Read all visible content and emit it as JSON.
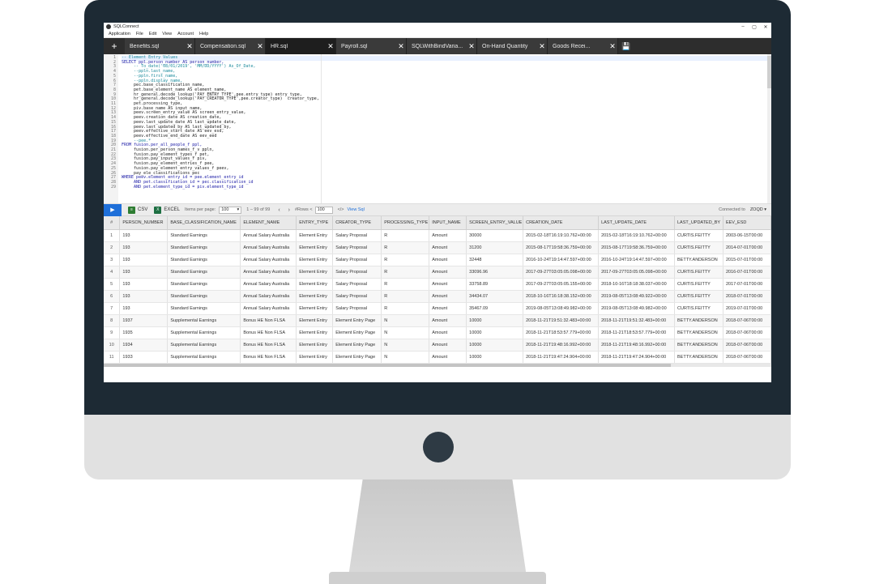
{
  "window": {
    "title": "SQLConnect",
    "controls": [
      "–",
      "▢",
      "✕"
    ]
  },
  "menu": [
    "Application",
    "File",
    "Edit",
    "View",
    "Account",
    "Help"
  ],
  "tabs": [
    {
      "label": "Benefits.sql",
      "active": false
    },
    {
      "label": "Compensation.sql",
      "active": false
    },
    {
      "label": "HR.sql",
      "active": true
    },
    {
      "label": "Payroll.sql",
      "active": false
    },
    {
      "label": "SQLWithBindVaria...",
      "active": false
    },
    {
      "label": "On-Hand Quantity",
      "active": false
    },
    {
      "label": "Goods Recei...",
      "active": false
    }
  ],
  "editor": {
    "line_numbers": [
      "1",
      "2",
      "3",
      "4",
      "5",
      "6",
      "7",
      "8",
      "9",
      "10",
      "11",
      "12",
      "13",
      "14",
      "15",
      "16",
      "17",
      "18",
      "19",
      "20",
      "21",
      "22",
      "23",
      "24",
      "25",
      "26",
      "27",
      "28",
      "29"
    ],
    "lines": [
      "-- Element Entry Values",
      "SELECT ppl.person_number AS person_number,",
      "     -- To_date('08/01/2019', 'MM/DD/YYYY') As_Of_Date,",
      "     --ppln.last_name,",
      "     --ppln.first_name,",
      "     --ppln.display_name,",
      "     pec.base_classification_name,",
      "     pet.base_element_name AS element_name,",
      "     hr_general.decode_lookup('PAY_ENTRY_TYPE',pee.entry_type) entry_type,",
      "     hr_general.decode_lookup('PAY_CREATOR_TYPE',pee.creator_type)  creator_type,",
      "     pet.processing_type,",
      "     piv.base_name AS input_name,",
      "     peev.screen_entry_value AS screen_entry_value,",
      "     peev.creation_date AS creation_date,",
      "     peev.last_update_date AS last_update_date,",
      "     peev.last_updated_by AS last_updated_by,",
      "     peev.effective_start_date AS eev_esd,",
      "     peev.effective_end_date AS eev_eed",
      "     --pee.*",
      "FROM fusion.per_all_people_f ppl,",
      "     fusion.per_person_names_f_v ppln,",
      "     fusion.pay_element_types_f pet,",
      "     fusion.pay_input_values_f piv,",
      "     fusion.pay_element_entries_f pee,",
      "     fusion.pay_element_entry_values_f peev,",
      "     pay_ele_classifications pec",
      "WHERE peev.element_entry_id = pee.element_entry_id",
      "     AND pet.classification_id = pec.classification_id",
      "     AND pet.element_type_id = piv.element_type_id"
    ]
  },
  "toolbar": {
    "run_icon": "▶",
    "csv_label": "CSV",
    "excel_label": "EXCEL",
    "items_per_page_label": "Items per page:",
    "items_per_page_value": "100",
    "range_text": "1 – 99 of 99",
    "rows_label": "#Rows <",
    "rows_value": "100",
    "view_sql_label": "View Sql",
    "connected_label": "Connected to",
    "connected_value": "ZOQD"
  },
  "grid": {
    "columns": [
      "#",
      "PERSON_NUMBER",
      "BASE_CLASSIFICATION_NAME",
      "ELEMENT_NAME",
      "ENTRY_TYPE",
      "CREATOR_TYPE",
      "PROCESSING_TYPE",
      "INPUT_NAME",
      "SCREEN_ENTRY_VALUE",
      "CREATION_DATE",
      "LAST_UPDATE_DATE",
      "LAST_UPDATED_BY",
      "EEV_ESD"
    ],
    "rows": [
      [
        "1",
        "193",
        "Standard Earnings",
        "Annual Salary Australia",
        "Element Entry",
        "Salary Proposal",
        "R",
        "Amount",
        "30000",
        "2015-02-18T16:19:10.762+00:00",
        "2015-02-18T16:19:10.762+00:00",
        "CURTIS.FEITTY",
        "2003-06-15T00:00"
      ],
      [
        "2",
        "193",
        "Standard Earnings",
        "Annual Salary Australia",
        "Element Entry",
        "Salary Proposal",
        "R",
        "Amount",
        "31200",
        "2015-08-17T19:58:36.759+00:00",
        "2015-08-17T19:58:36.759+00:00",
        "CURTIS.FEITTY",
        "2014-07-01T00:00"
      ],
      [
        "3",
        "193",
        "Standard Earnings",
        "Annual Salary Australia",
        "Element Entry",
        "Salary Proposal",
        "R",
        "Amount",
        "32448",
        "2016-10-24T19:14:47.597+00:00",
        "2016-10-24T19:14:47.597+00:00",
        "BETTY.ANDERSON",
        "2015-07-01T00:00"
      ],
      [
        "4",
        "193",
        "Standard Earnings",
        "Annual Salary Australia",
        "Element Entry",
        "Salary Proposal",
        "R",
        "Amount",
        "33096.96",
        "2017-09-27T03:05:05.098+00:00",
        "2017-09-27T03:05:05.098+00:00",
        "CURTIS.FEITTY",
        "2016-07-01T00:00"
      ],
      [
        "5",
        "193",
        "Standard Earnings",
        "Annual Salary Australia",
        "Element Entry",
        "Salary Proposal",
        "R",
        "Amount",
        "33758.89",
        "2017-09-27T03:05:05.155+00:00",
        "2018-10-16T18:18:38.037+00:00",
        "CURTIS.FEITTY",
        "2017-07-01T00:00"
      ],
      [
        "6",
        "193",
        "Standard Earnings",
        "Annual Salary Australia",
        "Element Entry",
        "Salary Proposal",
        "R",
        "Amount",
        "34434.07",
        "2018-10-16T16:18:38.152+00:00",
        "2019-08-05T13:08:49.922+00:00",
        "CURTIS.FEITTY",
        "2018-07-01T00:00"
      ],
      [
        "7",
        "193",
        "Standard Earnings",
        "Annual Salary Australia",
        "Element Entry",
        "Salary Proposal",
        "R",
        "Amount",
        "35467.09",
        "2019-08-05T13:08:49.982+00:00",
        "2019-08-05T13:08:49.982+00:00",
        "CURTIS.FEITTY",
        "2019-07-01T00:00"
      ],
      [
        "8",
        "1937",
        "Supplemental Earnings",
        "Bonus HE Non FLSA",
        "Element Entry",
        "Element Entry Page",
        "N",
        "Amount",
        "10000",
        "2018-11-21T19:51:32.483+00:00",
        "2018-11-21T19:51:32.483+00:00",
        "BETTY.ANDERSON",
        "2018-07-06T00:00"
      ],
      [
        "9",
        "1935",
        "Supplemental Earnings",
        "Bonus HE Non FLSA",
        "Element Entry",
        "Element Entry Page",
        "N",
        "Amount",
        "10000",
        "2018-11-21T18:53:57.779+00:00",
        "2018-11-21T18:53:57.779+00:00",
        "BETTY.ANDERSON",
        "2018-07-06T00:00"
      ],
      [
        "10",
        "1934",
        "Supplemental Earnings",
        "Bonus HE Non FLSA",
        "Element Entry",
        "Element Entry Page",
        "N",
        "Amount",
        "10000",
        "2018-11-21T19:48:16.992+00:00",
        "2018-11-21T19:48:16.992+00:00",
        "BETTY.ANDERSON",
        "2018-07-06T00:00"
      ],
      [
        "11",
        "1933",
        "Supplemental Earnings",
        "Bonus HE Non FLSA",
        "Element Entry",
        "Element Entry Page",
        "N",
        "Amount",
        "10000",
        "2018-11-21T19:47:24.904+00:00",
        "2018-11-21T19:47:24.904+00:00",
        "BETTY.ANDERSON",
        "2018-07-06T00:00"
      ],
      [
        "12",
        "1931",
        "Supplemental Earnings",
        "Bonus HE Non FLSA",
        "Element Entry",
        "Element Entry Page",
        "N",
        "Amount",
        "10000",
        "2018-11-21T18:52:51.523+00:00",
        "2018-11-21T18:52:51.523+00:00",
        "BETTY.ANDERSON",
        "2016-07-01T00:00"
      ]
    ]
  },
  "colors": {
    "bezel": "#1d2a34",
    "tab_bar": "#2d2d2d",
    "accent": "#1e6fd9"
  }
}
